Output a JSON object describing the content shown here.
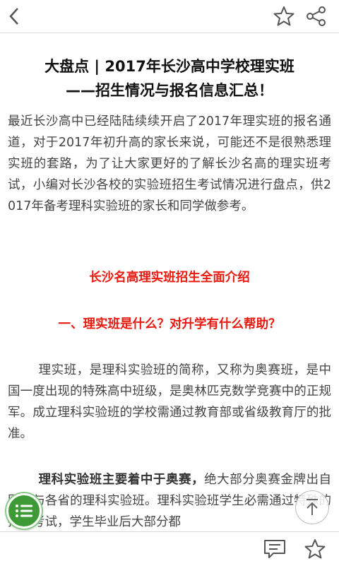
{
  "header": {
    "back_icon": "chevron-left-icon",
    "favorite_icon": "star-outline-icon",
    "share_icon": "share-icon"
  },
  "article": {
    "title_line1": "大盘点 | 2017年长沙高中学校理实班",
    "title_line2": "——招生情况与报名信息汇总！",
    "intro": "最近长沙高中已经陆陆续续开启了2017年理实班的报名通道，对于2017年初升高的家长来说，可能还不是很熟悉理实班的套路，为了让大家更好的了解长沙名高的理实班考试，小编对长沙各校的实验班招生考试情况进行盘点，供2017年备考理科实验班的家长和同学做参考。",
    "section_heading": "长沙名高理实班招生全面介绍",
    "question_heading": "一、理实班是什么？对升学有什么帮助？",
    "para2": "理实班，是理科实验班的简称，又称为奥赛班，是中国一度出现的特殊高中班级，是奥林匹克数学竞赛中的正规军。成立理科实验班的学校需通过教育部或省级教育厅的批准。",
    "para3_bold": "理科实验班主要着中于奥赛，",
    "para3_rest": "绝大部分奥赛金牌出自国家与各省的理科实验班。理科实验班学生必需通过特殊的招生考试，学生毕业后大部分都"
  },
  "floating": {
    "menu_icon": "list-menu-icon",
    "scroll_top_icon": "arrow-up-icon"
  },
  "footer": {
    "comment_icon": "comment-icon",
    "favorite_icon": "star-outline-icon"
  },
  "colors": {
    "accent_red": "#e8190f",
    "fab_green": "#3d9a36",
    "icon_gray": "#555555"
  }
}
